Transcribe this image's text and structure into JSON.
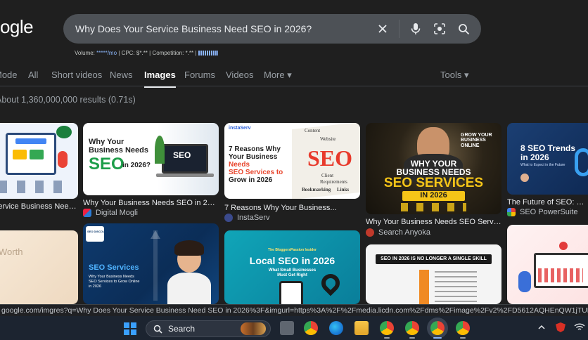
{
  "logo": {
    "text": "oogle"
  },
  "search": {
    "query": "Why Does Your Service Business Need SEO in 2026?"
  },
  "seo_bar": {
    "volume_label": "Volume: ",
    "volume_value": "*****/mo",
    "rest": " | CPC: $*.** | Competition: *.** | "
  },
  "tabs": [
    {
      "label": "Mode"
    },
    {
      "label": "All"
    },
    {
      "label": "Short videos"
    },
    {
      "label": "News"
    },
    {
      "label": "Images"
    },
    {
      "label": "Forums"
    },
    {
      "label": "Videos"
    },
    {
      "label": "More ▾"
    },
    {
      "label": "Tools ▾"
    }
  ],
  "results_stats": "About 1,360,000,000 results (0.71s)",
  "row1": [
    {
      "title": "Service Business Need..."
    },
    {
      "title": "Why Your Business Needs SEO in 2026?...",
      "source": "Digital Mogli",
      "img": {
        "l1": "Why Your",
        "l2": "Business Needs",
        "l3": "SEO",
        "l4": "in 2026?",
        "screen": "SEO"
      }
    },
    {
      "title": "7 Reasons Why Your Business...",
      "source": "InstaServ",
      "img": {
        "brand": "instaServ",
        "l1": "7 Reasons Why",
        "l2": "Your Business",
        "l3": "Needs",
        "l4": "SEO Services to",
        "l5": "Grow in 2026",
        "big": "SEO",
        "w1": "Content",
        "w2": "Website",
        "w3": "Client",
        "w4": "Requirements",
        "w5": "Bookmarking",
        "w6": "Links"
      }
    },
    {
      "title": "Why Your Business Needs SEO Service...",
      "source": "Search Anyoka",
      "img": {
        "l1": "WHY YOUR",
        "l2": "BUSINESS NEEDS",
        "l3": "SEO SERVICES",
        "l4": "IN 2026",
        "grow": "GROW YOUR BUSINESS ONLINE"
      }
    },
    {
      "title": "The Future of SEO: What...",
      "source": "SEO PowerSuite",
      "img": {
        "l1": "8 SEO Trends",
        "l2": "in 2026",
        "l3": "What to Expect in the Future"
      }
    }
  ],
  "row2": [
    {
      "img": {
        "l1": "Worth"
      }
    },
    {
      "img": {
        "badge": "SEO DISCOVERY",
        "l1": "SEO Services",
        "l2": "Why Your Business Needs",
        "l3": "SEO Services to Grow Online",
        "l4": "in 2026"
      }
    },
    {
      "img": {
        "l0": "The BloggersPassion Insider",
        "l1": "Local SEO in 2026",
        "l2": "What Small Businesses",
        "l3": "Must Get Right"
      }
    },
    {
      "img": {
        "l1": "SEO IN 2026 IS NO LONGER A SINGLE SKILL"
      }
    },
    {
      "img": {}
    }
  ],
  "status_url": "google.com/imgres?q=Why Does Your Service Business Need SEO in 2026%3F&imgurl=https%3A%2F%2Fmedia.licdn.com%2Fdms%2Fimage%2Fv2%2FD5612AQHEnQW1jTUFyQ%2Farticle-cover_image-shrink_720_1280",
  "taskbar": {
    "search_label": "Search"
  },
  "colors": {
    "background": "#1f1f1f",
    "search_box": "#4d5156",
    "link": "#8ab4f8",
    "taskbar": "#1c2430"
  }
}
